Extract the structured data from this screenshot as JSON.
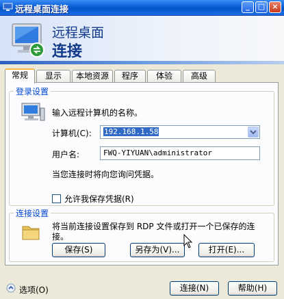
{
  "window": {
    "title": "远程桌面连接",
    "buttons": {
      "minimize": "_",
      "maximize": "□",
      "close": "×"
    }
  },
  "banner": {
    "line1": "远程桌面",
    "line2": "连接"
  },
  "tabs": [
    "常规",
    "显示",
    "本地资源",
    "程序",
    "体验",
    "高级"
  ],
  "login": {
    "legend": "登录设置",
    "instruction": "输入远程计算机的名称。",
    "computer_label": "计算机(C):",
    "computer_value": "192.168.1.58",
    "username_label": "用户名:",
    "username_value": "FWQ-YIYUAN\\administrator",
    "credential_note": "当您连接时将向您询问凭据。",
    "save_credentials_label": "允许我保存凭据(R)",
    "save_credentials_checked": false
  },
  "connection": {
    "legend": "连接设置",
    "description_line1": "将当前连接设置保存到 RDP 文件或打开一个已保存的连",
    "description_line2": "接。",
    "save_button": "保存(S)",
    "save_as_button": "另存为(V)...",
    "open_button": "打开(E)..."
  },
  "footer": {
    "options_label": "选项(O)",
    "connect_button": "连接(N)",
    "help_button": "帮助(H)"
  },
  "colors": {
    "title_bar": "#0a5fd8",
    "legend": "#0046d5",
    "selection": "#316ac5"
  }
}
